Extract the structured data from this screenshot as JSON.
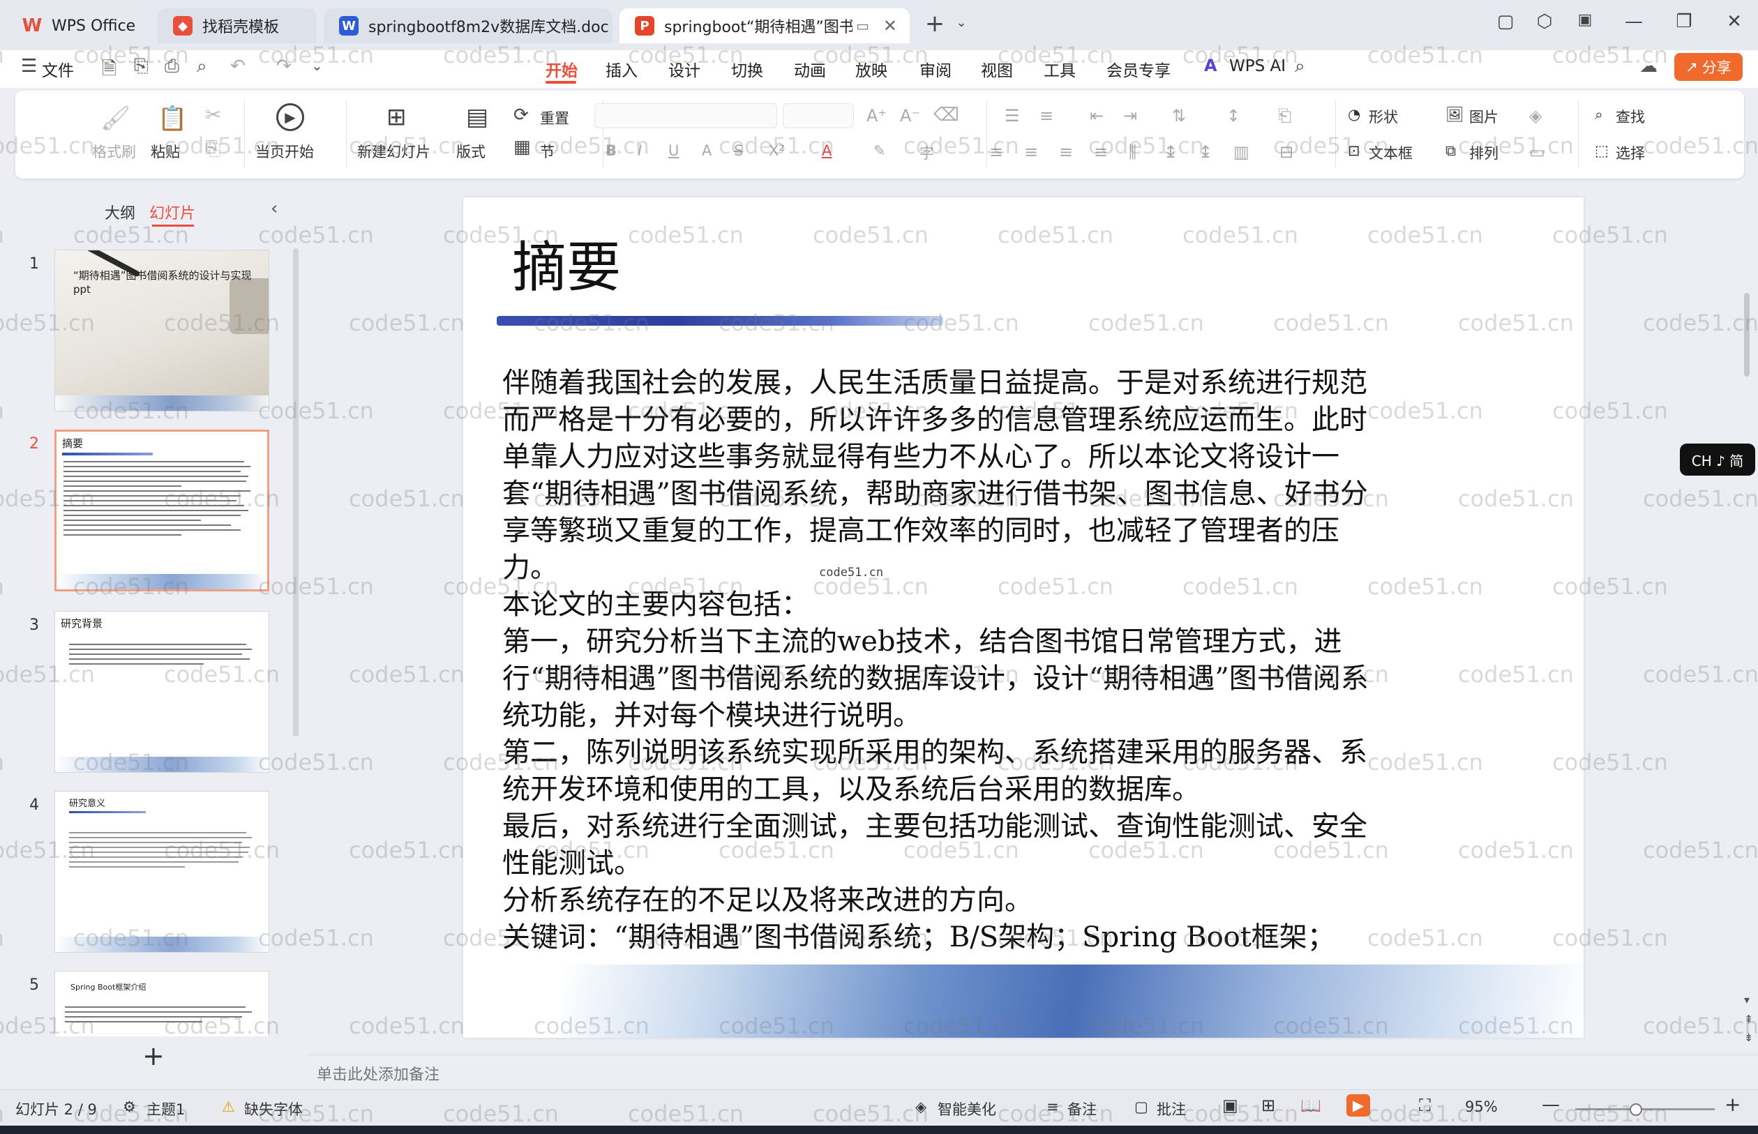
{
  "tabs": [
    {
      "label": "WPS Office",
      "icon": "wps-logo-icon",
      "color": "#e8503b"
    },
    {
      "label": "找稻壳模板",
      "icon": "docer-icon",
      "color": "#e8503b"
    },
    {
      "label": "springbootf8m2v数据库文档.doc",
      "icon": "word-doc-icon",
      "color": "#2b5bd7"
    },
    {
      "label": "springboot“期待相遇”图书",
      "icon": "ppt-icon",
      "color": "#e3452d"
    }
  ],
  "menu": {
    "file": "文件",
    "items": [
      "开始",
      "插入",
      "设计",
      "切换",
      "动画",
      "放映",
      "审阅",
      "视图",
      "工具",
      "会员专享"
    ],
    "active": "开始",
    "wps_ai": "WPS AI",
    "share": "分享"
  },
  "ribbon": {
    "format_brush": "格式刷",
    "paste": "粘贴",
    "play_from_current": "当页开始",
    "new_slide": "新建幻灯片",
    "layout": "版式",
    "reset": "重置",
    "section": "节",
    "shape": "形状",
    "picture": "图片",
    "find": "查找",
    "textbox": "文本框",
    "arrange": "排列",
    "select": "选择"
  },
  "panel": {
    "outline_tab": "大纲",
    "slides_tab": "幻灯片",
    "add_slide": "+"
  },
  "thumbnails": [
    {
      "num": "1",
      "title": "“期待相遇”图书借阅系统的设计与实现ppt"
    },
    {
      "num": "2",
      "title": "摘要"
    },
    {
      "num": "3",
      "title": "研究背景"
    },
    {
      "num": "4",
      "title": "研究意义"
    },
    {
      "num": "5",
      "title": "Spring Boot框架介绍"
    }
  ],
  "slide": {
    "title": "摘要",
    "paragraphs": [
      "伴随着我国社会的发展，人民生活质量日益提高。于是对系统进行规范而严格是十分有必要的，所以许许多多的信息管理系统应运而生。此时单靠人力应对这些事务就显得有些力不从心了。所以本论文将设计一套“期待相遇”图书借阅系统，帮助商家进行借书架、图书信息、好书分享等繁琐又重复的工作，提高工作效率的同时，也减轻了管理者的压力。",
      "本论文的主要内容包括：",
      "第一，研究分析当下主流的web技术，结合图书馆日常管理方式，进行“期待相遇”图书借阅系统的数据库设计，设计“期待相遇”图书借阅系统功能，并对每个模块进行说明。",
      "第二，陈列说明该系统实现所采用的架构、系统搭建采用的服务器、系统开发环境和使用的工具，以及系统后台采用的数据库。",
      "最后，对系统进行全面测试，主要包括功能测试、查询性能测试、安全性能测试。",
      "分析系统存在的不足以及将来改进的方向。",
      "关键词：“期待相遇”图书借阅系统；B/S架构；Spring Boot框架；"
    ],
    "tiny_overlay": "code51.cn"
  },
  "notes_placeholder": "单击此处添加备注",
  "status": {
    "slide_counter": "幻灯片 2 / 9",
    "theme": "主题1",
    "missing_font": "缺失字体",
    "smart_beautify": "智能美化",
    "notes": "备注",
    "comments": "批注",
    "zoom": "95%"
  },
  "ime": "CH ♪ 简",
  "watermark": "code51.cn",
  "colors": {
    "accent": "#e8503b",
    "share_bg": "#f06a2d"
  }
}
